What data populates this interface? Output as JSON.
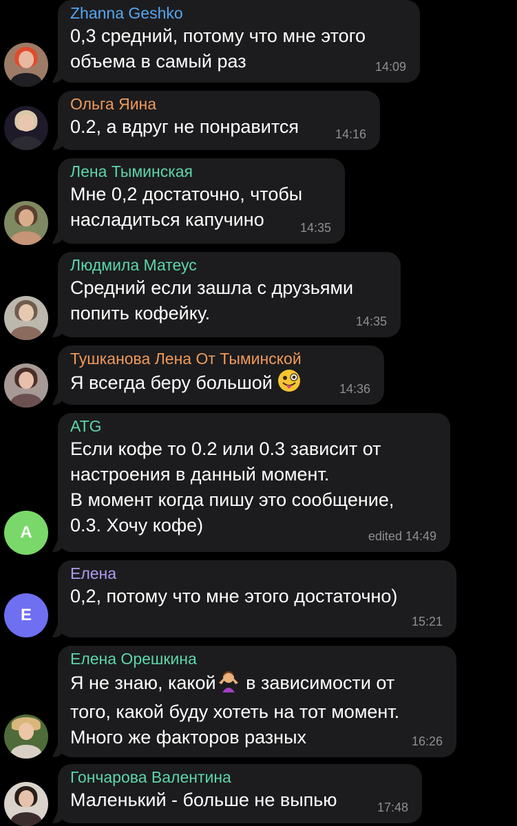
{
  "colors": {
    "background": "#000000",
    "bubble": "#1c1c1e",
    "time": "#8e8e93"
  },
  "messages": [
    {
      "sender": "Zhanna Geshko",
      "sender_color": "#55a6f0",
      "lines": [
        "0,3 средний, потому что мне этого",
        "объема в самый раз"
      ],
      "time": "14:09"
    },
    {
      "sender": "Ольга Яина",
      "sender_color": "#f09a5a",
      "lines": [
        "0.2, а вдруг не понравится"
      ],
      "time": "14:16"
    },
    {
      "sender": "Лена Тыминская",
      "sender_color": "#5dd6a9",
      "lines": [
        "Мне 0,2 достаточно, чтобы",
        "насладиться капучино"
      ],
      "time": "14:35"
    },
    {
      "sender": "Людмила Матеус",
      "sender_color": "#5dd6a9",
      "lines": [
        "Средний если зашла с друзьями",
        "попить кофейку."
      ],
      "time": "14:35"
    },
    {
      "sender": "Тушканова Лена От Тыминской",
      "sender_color": "#f09a5a",
      "lines": [
        "Я всегда беру большой"
      ],
      "time": "14:36",
      "emoji": "winking-tongue-face-emoji"
    },
    {
      "sender": "ATG",
      "sender_color": "#5dd6a9",
      "lines": [
        "Если кофе то 0.2 или 0.3 зависит от",
        "настроения в данный момент.",
        "В момент когда пишу это сообщение,",
        "0.3. Хочу кофе)"
      ],
      "time": "edited 14:49",
      "avatar_letter": "A",
      "avatar_color": "#7ad86a"
    },
    {
      "sender": "Елена",
      "sender_color": "#b09af0",
      "lines": [
        "0,2, потому что мне этого достаточно)"
      ],
      "time": "15:21",
      "avatar_letter": "E",
      "avatar_color": "#6f6ff2"
    },
    {
      "sender": "Елена Орешкина",
      "sender_color": "#5dd6a9",
      "lines": [
        "Я не знаю, какой",
        "того, какой буду хотеть на тот момент.",
        "Много же факторов разных"
      ],
      "line1_suffix": " в зависимости от",
      "time": "16:26",
      "emoji": "person-shrugging-emoji"
    },
    {
      "sender": "Гончарова Валентина",
      "sender_color": "#5dd6a9",
      "lines": [
        "Маленький - больше не выпью"
      ],
      "time": "17:48"
    }
  ]
}
